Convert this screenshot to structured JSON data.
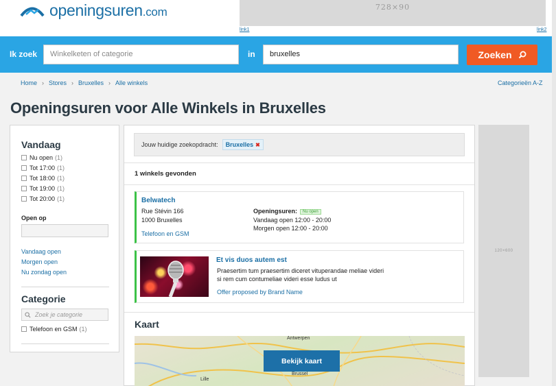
{
  "header": {
    "logo_text": "openingsuren",
    "logo_suffix": ".com",
    "ad_label": "728×90",
    "ad_link_left": "link1",
    "ad_link_right": "link2"
  },
  "search": {
    "ik_zoek_label": "Ik zoek",
    "what_placeholder": "Winkelketen of categorie",
    "in_label": "in",
    "where_value": "bruxelles",
    "button_label": "Zoeken"
  },
  "breadcrumb": [
    "Home",
    "Stores",
    "Bruxelles",
    "Alle winkels"
  ],
  "categories_link": "Categorieën A-Z",
  "page_title": "Openingsuren voor Alle Winkels in Bruxelles",
  "sidebar": {
    "vandaag_title": "Vandaag",
    "vandaag_items": [
      {
        "label": "Nu open",
        "count": "(1)"
      },
      {
        "label": "Tot 17:00",
        "count": "(1)"
      },
      {
        "label": "Tot 18:00",
        "count": "(1)"
      },
      {
        "label": "Tot 19:00",
        "count": "(1)"
      },
      {
        "label": "Tot 20:00",
        "count": "(1)"
      }
    ],
    "open_op_label": "Open op",
    "quick_links": [
      "Vandaag open",
      "Morgen open",
      "Nu zondag open"
    ],
    "categorie_title": "Categorie",
    "categorie_search_placeholder": "Zoek je categorie",
    "categorie_items": [
      {
        "label": "Telefoon en GSM",
        "count": "(1)"
      }
    ]
  },
  "main": {
    "current_query_label": "Jouw huidige zoekopdracht:",
    "current_query_tag": "Bruxelles",
    "found_text": "1 winkels gevonden",
    "store": {
      "name": "Belwatech",
      "address1": "Rue Stévin 166",
      "address2": "1000 Bruxelles",
      "category_link": "Telefoon en GSM",
      "hours_label": "Openingsuren:",
      "status_badge": "Nu open",
      "today": "Vandaag open 12:00 - 20:00",
      "tomorrow": "Morgen open 12:00 - 20:00"
    },
    "promo": {
      "title": "Et vis duos autem est",
      "line1": "Praesertim tum praesertim diceret vituperandae meliae videri",
      "line2": "si rem cum contumeliae videri esse ludus ut",
      "link": "Offer proposed by Brand Name"
    },
    "kaart_title": "Kaart",
    "map_button": "Bekijk kaart",
    "map_labels": [
      "Antwerpen",
      "Brussel",
      "Lille"
    ]
  },
  "side_ad_label": "120×600",
  "colors": {
    "brand_blue": "#2aa5e4",
    "link_blue": "#1b6fa5",
    "search_orange": "#f05a24",
    "open_green": "#3cc247"
  }
}
